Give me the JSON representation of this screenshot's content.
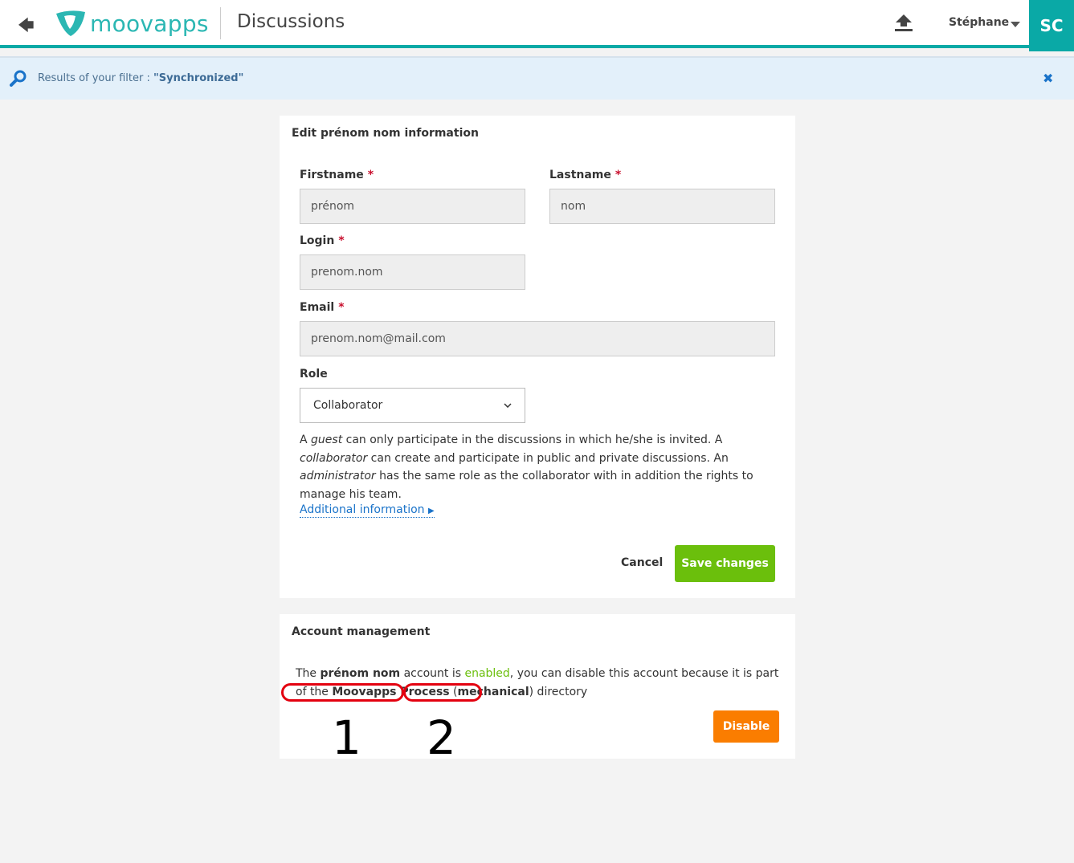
{
  "header": {
    "app_title": "Discussions",
    "logo_text": "moovapps",
    "user_name": "Stéphane",
    "avatar_initials": "SC",
    "accent": "#0aa9a6"
  },
  "filter": {
    "label": "Results of your filter :",
    "value": "\"Synchronized\""
  },
  "edit_card": {
    "title": "Edit prénom nom information",
    "firstname": {
      "label": "Firstname",
      "value": "prénom"
    },
    "lastname": {
      "label": "Lastname",
      "value": "nom"
    },
    "login": {
      "label": "Login",
      "value": "prenom.nom"
    },
    "email": {
      "label": "Email",
      "value": "prenom.nom@mail.com"
    },
    "required_mark": "*",
    "role": {
      "label": "Role",
      "value": "Collaborator"
    },
    "help": {
      "p1": "A ",
      "guest": "guest",
      "p2": " can only participate in the discussions in which he/she is invited. A ",
      "collaborator": "collaborator",
      "p3": " can create and participate in public and private discussions. An ",
      "administrator": "administrator",
      "p4": " has the same role as the collaborator with in addition the rights to manage his team."
    },
    "additional_info": "Additional information",
    "cancel": "Cancel",
    "save": "Save changes",
    "save_color": "#6bbf0c"
  },
  "account_card": {
    "title": "Account management",
    "t1": "The ",
    "name": "prénom nom",
    "t2": " account is ",
    "status": "enabled",
    "t3": ", you can disable this account because it is part of the ",
    "directory": "Moovapps Process",
    "t4": " (",
    "type": "mechanical",
    "t5": ") directory",
    "disable": "Disable",
    "disable_color": "#fa7d00"
  },
  "annotations": {
    "n1": "1",
    "n2": "2",
    "color": "#e3000f"
  }
}
